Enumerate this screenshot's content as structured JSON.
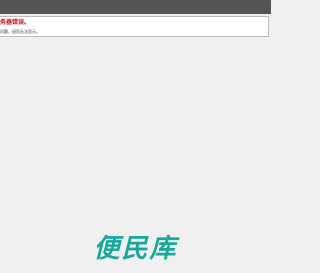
{
  "error": {
    "title": "务器错误。",
    "detail": "问题，因而无法显示。"
  },
  "watermark": {
    "text": "便民库"
  },
  "colors": {
    "topbar": "#555555",
    "error_title": "#c8161d",
    "watermark": "#1aa89a",
    "background": "#f0f0f0"
  }
}
